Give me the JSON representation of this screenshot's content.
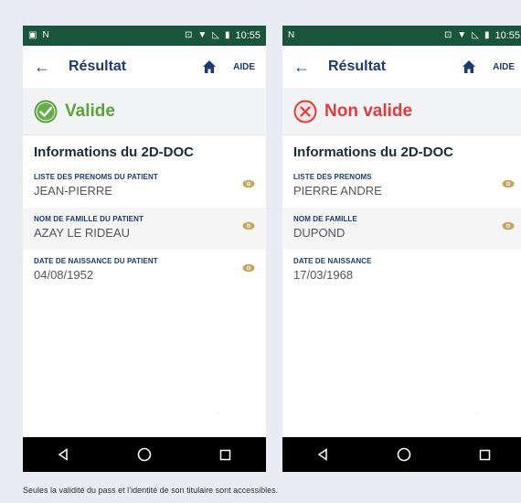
{
  "statusbar": {
    "time": "10:55"
  },
  "phones": [
    {
      "appbar": {
        "title": "Résultat",
        "help_label": "AIDE"
      },
      "status": {
        "text": "Valide",
        "valid": true
      },
      "section_title": "Informations du 2D-DOC",
      "fields": [
        {
          "label": "LISTE DES PRENOMS DU PATIENT",
          "value": "JEAN-PIERRE"
        },
        {
          "label": "NOM DE FAMILLE DU PATIENT",
          "value": "AZAY LE RIDEAU"
        },
        {
          "label": "DATE DE NAISSANCE DU PATIENT",
          "value": "04/08/1952"
        }
      ]
    },
    {
      "appbar": {
        "title": "Résultat",
        "help_label": "AIDE"
      },
      "status": {
        "text": "Non valide",
        "valid": false
      },
      "section_title": "Informations du 2D-DOC",
      "fields": [
        {
          "label": "LISTE DES PRENOMS",
          "value": "PIERRE ANDRE"
        },
        {
          "label": "NOM DE FAMILLE",
          "value": "DUPOND"
        },
        {
          "label": "DATE DE NAISSANCE",
          "value": "17/03/1968"
        }
      ]
    }
  ],
  "caption": "Seules la validité du pass et l’identité de son titulaire sont accessibles.",
  "colors": {
    "statusbar": "#19553a",
    "primary": "#1d3b6e",
    "valid": "#56a536",
    "invalid": "#e23b3b",
    "eye": "#c9a55a"
  },
  "icons": [
    "back-arrow",
    "home",
    "check-circle",
    "cross-circle",
    "eye",
    "nav-back",
    "nav-home",
    "nav-recents"
  ]
}
